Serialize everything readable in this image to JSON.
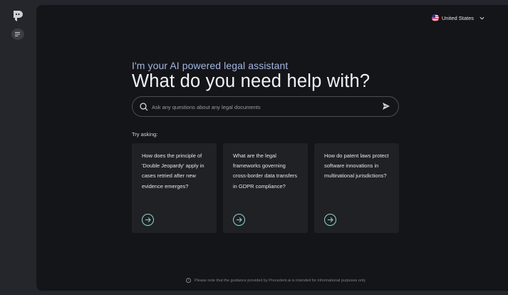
{
  "sidebar": {
    "logo_icon": "precedent-logo-icon",
    "menu_icon": "menu-lines-icon"
  },
  "header": {
    "country_label": "United States",
    "country_flag": "us-flag-icon"
  },
  "hero": {
    "subtitle": "I'm your AI powered legal assistant",
    "headline": "What do you need help with?"
  },
  "search": {
    "placeholder": "Ask any questions about any legal documents",
    "value": "",
    "icon": "search-icon",
    "send_icon": "send-icon"
  },
  "suggestions": {
    "label": "Try asking:",
    "items": [
      {
        "text": "How does the principle of 'Double Jeopardy' apply in cases retried after new evidence emerges?"
      },
      {
        "text": "What are the legal frameworks governing cross-border data transfers in GDPR compliance?"
      },
      {
        "text": "How do patent laws protect software innovations in multinational jurisdictions?"
      }
    ]
  },
  "footer": {
    "disclaimer": "Please note that the guidance provided by Precedent.ai is intended for informational purposes only"
  },
  "colors": {
    "accent_blue": "#9fb6e6",
    "arrow_teal": "#8fd4cc",
    "background": "#141518",
    "card": "#1f2125"
  }
}
